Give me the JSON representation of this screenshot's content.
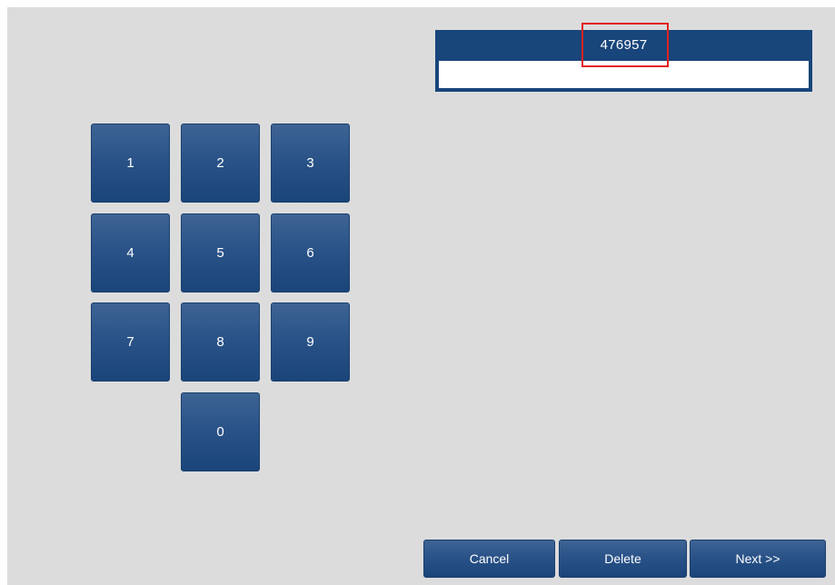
{
  "code_panel": {
    "header_value": "476957",
    "input_value": ""
  },
  "keypad": {
    "keys": [
      "1",
      "2",
      "3",
      "4",
      "5",
      "6",
      "7",
      "8",
      "9",
      "0"
    ]
  },
  "actions": {
    "cancel_label": "Cancel",
    "delete_label": "Delete",
    "next_label": "Next >>"
  },
  "colors": {
    "background": "#dcdcdc",
    "button_blue": "#2a5388",
    "panel_blue": "#18457a",
    "highlight_red": "#e0201f"
  }
}
